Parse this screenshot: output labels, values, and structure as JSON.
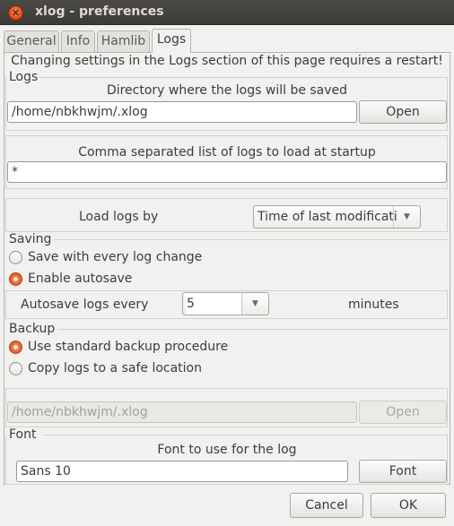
{
  "window": {
    "title": "xlog - preferences"
  },
  "tabs": [
    {
      "label": "General",
      "active": false
    },
    {
      "label": "Info",
      "active": false
    },
    {
      "label": "Hamlib",
      "active": false
    },
    {
      "label": "Logs",
      "active": true
    }
  ],
  "notice": "Changing settings in the Logs section of this page requires a restart!",
  "logs": {
    "section_label": "Logs",
    "dir_caption": "Directory where the logs will be saved",
    "dir_value": "/home/nbkhwjm/.xlog",
    "open_label": "Open",
    "list_caption": "Comma separated list of logs to load at startup",
    "list_value": "*",
    "load_by_label": "Load logs by",
    "load_by_value": "Time of last modificati"
  },
  "saving": {
    "section_label": "Saving",
    "option_every": "Save with every log change",
    "option_autosave": "Enable autosave",
    "selected": "autosave",
    "autosave_label": "Autosave logs every",
    "autosave_value": "5",
    "minutes_label": "minutes"
  },
  "backup": {
    "section_label": "Backup",
    "option_standard": "Use standard backup procedure",
    "option_copy": "Copy logs to a safe location",
    "selected": "standard",
    "location_value": "/home/nbkhwjm/.xlog",
    "open_label": "Open"
  },
  "font": {
    "section_label": "Font",
    "caption": "Font to use for the log",
    "value": "Sans 10",
    "button_label": "Font"
  },
  "footer": {
    "cancel_label": "Cancel",
    "ok_label": "OK"
  },
  "colors": {
    "titlebar": "#3c3b37",
    "accent": "#dd4814",
    "background": "#f2f1f0"
  }
}
